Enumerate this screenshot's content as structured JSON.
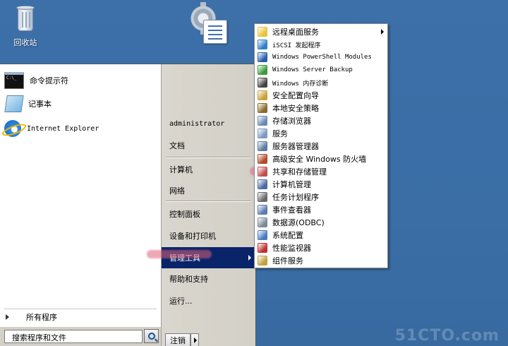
{
  "desktop": {
    "recycle_bin_label": "回收站"
  },
  "start_menu": {
    "pinned": [
      {
        "label": "命令提示符",
        "icon": "cmd-icon"
      },
      {
        "label": "记事本",
        "icon": "notepad-icon"
      },
      {
        "label": "Internet Explorer",
        "icon": "ie-icon"
      }
    ],
    "all_programs_label": "所有程序",
    "search_placeholder": "搜索程序和文件",
    "username": "administrator",
    "right_items": [
      {
        "label": "文档"
      },
      {
        "label": "计算机"
      },
      {
        "label": "网络"
      },
      {
        "label": "控制面板"
      },
      {
        "label": "设备和打印机"
      },
      {
        "label": "管理工具",
        "highlighted": true,
        "has_submenu": true
      },
      {
        "label": "帮助和支持"
      },
      {
        "label": "运行..."
      }
    ],
    "logoff_label": "注销"
  },
  "admin_tools_submenu": [
    {
      "label": "远程桌面服务",
      "icon": "folder-icon",
      "color": "#e8c43a",
      "has_submenu": true
    },
    {
      "label": "iSCSI 发起程序",
      "icon": "globe-icon",
      "color": "#2f7fc9"
    },
    {
      "label": "Windows PowerShell Modules",
      "icon": "powershell-icon",
      "color": "#2a5caa"
    },
    {
      "label": "Windows Server Backup",
      "icon": "backup-icon",
      "color": "#3a9a3a"
    },
    {
      "label": "Windows 内存诊断",
      "icon": "memory-icon",
      "color": "#444444"
    },
    {
      "label": "安全配置向导",
      "icon": "security-wizard-icon",
      "color": "#c9a23a"
    },
    {
      "label": "本地安全策略",
      "icon": "local-policy-icon",
      "color": "#8a6a2a"
    },
    {
      "label": "存储浏览器",
      "icon": "storage-browser-icon",
      "color": "#6a8ab0"
    },
    {
      "label": "服务",
      "icon": "services-icon",
      "color": "#7a9ac0"
    },
    {
      "label": "服务器管理器",
      "icon": "server-manager-icon",
      "color": "#5a7aa0"
    },
    {
      "label": "高级安全 Windows 防火墙",
      "icon": "firewall-icon",
      "color": "#b04a2a"
    },
    {
      "label": "共享和存储管理",
      "icon": "share-storage-icon",
      "color": "#c05050"
    },
    {
      "label": "计算机管理",
      "icon": "computer-management-icon",
      "color": "#4a6aa0"
    },
    {
      "label": "任务计划程序",
      "icon": "task-scheduler-icon",
      "color": "#6a6a6a"
    },
    {
      "label": "事件查看器",
      "icon": "event-viewer-icon",
      "color": "#5a7ab0"
    },
    {
      "label": "数据源(ODBC)",
      "icon": "odbc-icon",
      "color": "#7a8a9a"
    },
    {
      "label": "系统配置",
      "icon": "system-config-icon",
      "color": "#4a7ac0"
    },
    {
      "label": "性能监视器",
      "icon": "performance-icon",
      "color": "#c03030"
    },
    {
      "label": "组件服务",
      "icon": "component-services-icon",
      "color": "#c0a040"
    }
  ],
  "watermark": "51CTO.com"
}
